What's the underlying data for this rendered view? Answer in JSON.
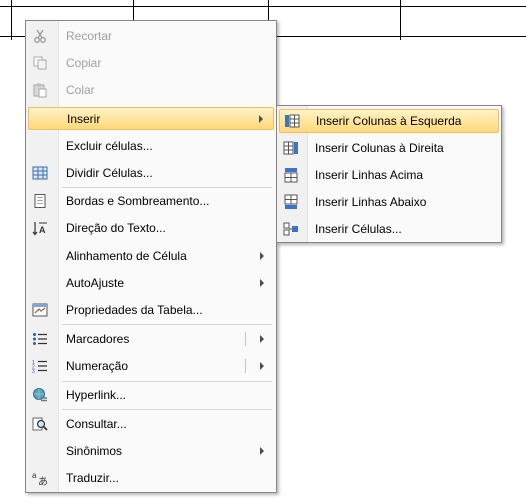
{
  "context_menu": {
    "items": [
      {
        "label": "Recortar",
        "icon": "cut-icon",
        "disabled": true
      },
      {
        "label": "Copiar",
        "icon": "copy-icon",
        "disabled": true
      },
      {
        "label": "Colar",
        "icon": "paste-icon",
        "disabled": true
      },
      {
        "label": "Inserir",
        "icon": "",
        "submenu": true,
        "highlighted": true
      },
      {
        "label": "Excluir células...",
        "icon": ""
      },
      {
        "label": "Dividir Células...",
        "icon": "split-cells-icon"
      },
      {
        "label": "Bordas e Sombreamento...",
        "icon": "borders-shading-icon"
      },
      {
        "label": "Direção do Texto...",
        "icon": "text-direction-icon"
      },
      {
        "label": "Alinhamento de Célula",
        "icon": "",
        "submenu": true
      },
      {
        "label": "AutoAjuste",
        "icon": "",
        "submenu": true
      },
      {
        "label": "Propriedades da Tabela...",
        "icon": "table-properties-icon"
      },
      {
        "label": "Marcadores",
        "icon": "bullets-icon",
        "submenu": true
      },
      {
        "label": "Numeração",
        "icon": "numbering-icon",
        "submenu": true
      },
      {
        "label": "Hyperlink...",
        "icon": "hyperlink-icon"
      },
      {
        "label": "Consultar...",
        "icon": "research-icon"
      },
      {
        "label": "Sinônimos",
        "icon": "",
        "submenu": true
      },
      {
        "label": "Traduzir...",
        "icon": "translate-icon"
      }
    ]
  },
  "insert_submenu": {
    "items": [
      {
        "label": "Inserir Colunas à Esquerda",
        "icon": "insert-columns-left-icon",
        "highlighted": true
      },
      {
        "label": "Inserir Colunas à Direita",
        "icon": "insert-columns-right-icon"
      },
      {
        "label": "Inserir Linhas Acima",
        "icon": "insert-rows-above-icon"
      },
      {
        "label": "Inserir Linhas Abaixo",
        "icon": "insert-rows-below-icon"
      },
      {
        "label": "Inserir Células...",
        "icon": "insert-cells-icon"
      }
    ]
  },
  "colors": {
    "highlight": "#ffd97a",
    "highlight_border": "#f1c15f",
    "disabled_text": "#a0a0a0",
    "menu_border": "#868686"
  }
}
